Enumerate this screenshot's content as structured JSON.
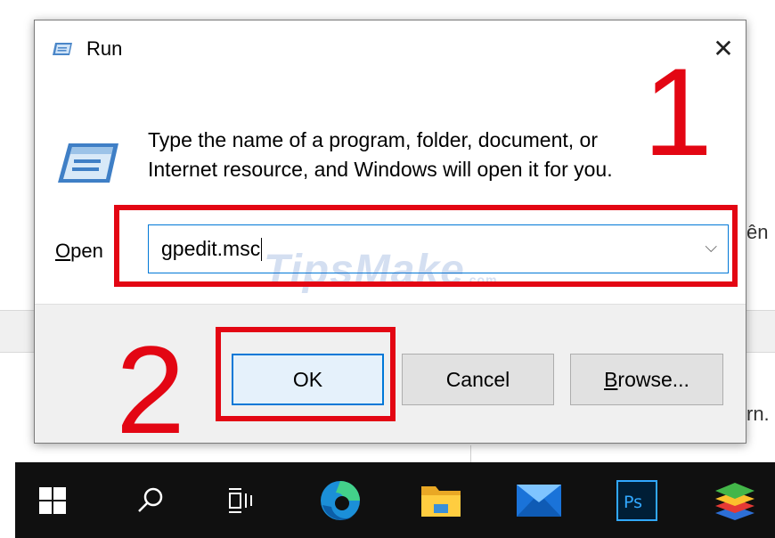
{
  "window": {
    "title": "Run",
    "close_glyph": "✕"
  },
  "dialog": {
    "description_line1": "Type the name of a program, folder, document, or",
    "description_line2": "Internet resource, and Windows will open it for you.",
    "open_label_accel": "O",
    "open_label_rest": "pen",
    "open_value": "gpedit.msc",
    "dropdown_glyph": "⌵"
  },
  "buttons": {
    "ok": "OK",
    "cancel": "Cancel",
    "browse_accel": "B",
    "browse_rest": "rowse..."
  },
  "annotations": {
    "step1": "1",
    "step2": "2",
    "color": "#e30613"
  },
  "watermark": {
    "text": "TipsMake",
    "suffix": ".com"
  },
  "background_text": {
    "top_fragment": "",
    "right_fragment_1": "ên",
    "right_fragment_2": "rn."
  },
  "taskbar": {
    "items": [
      "windows-start",
      "search",
      "task-view",
      "edge",
      "file-explorer",
      "mail",
      "photoshop",
      "bluestacks"
    ]
  }
}
